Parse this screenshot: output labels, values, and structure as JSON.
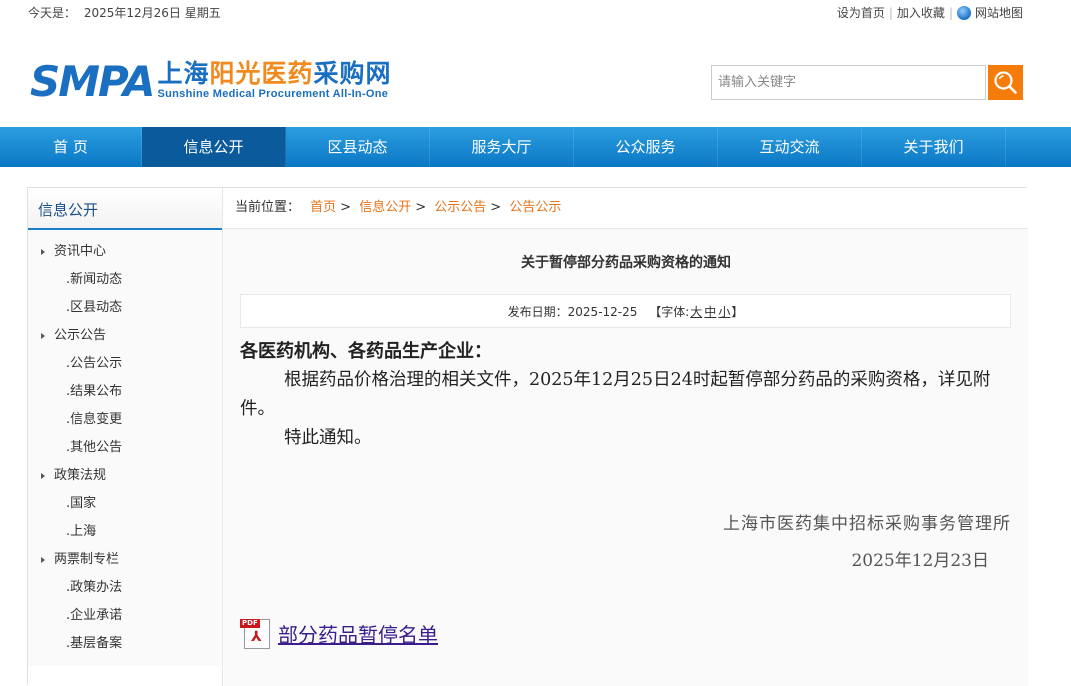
{
  "topbar": {
    "date_label": "今天是：",
    "date_value": "2025年12月26日 星期五",
    "links": [
      "设为首页",
      "加入收藏",
      "网站地图"
    ]
  },
  "header": {
    "logo_abbr": "SMPA",
    "logo_cn_blue1": "上海",
    "logo_cn_orange": "阳光医药",
    "logo_cn_blue2": "采购网",
    "logo_en": "Sunshine Medical Procurement All-In-One",
    "search_placeholder": "请输入关键字"
  },
  "nav": [
    "首 页",
    "信息公开",
    "区县动态",
    "服务大厅",
    "公众服务",
    "互动交流",
    "关于我们"
  ],
  "sidebar": {
    "title": "信息公开",
    "groups": [
      {
        "label": "资讯中心",
        "items": [
          ".新闻动态",
          ".区县动态"
        ]
      },
      {
        "label": "公示公告",
        "items": [
          ".公告公示",
          ".结果公布",
          ".信息变更",
          ".其他公告"
        ]
      },
      {
        "label": "政策法规",
        "items": [
          ".国家",
          ".上海"
        ]
      },
      {
        "label": "两票制专栏",
        "items": [
          ".政策办法",
          ".企业承诺",
          ".基层备案"
        ]
      }
    ]
  },
  "breadcrumb": {
    "label": "当前位置：",
    "items": [
      "首页",
      "信息公开",
      "公示公告",
      "公告公示"
    ]
  },
  "article": {
    "title": "关于暂停部分药品采购资格的通知",
    "publish_label": "发布日期：",
    "publish_date": "2025-12-25",
    "fontsize_prefix": "【字体:",
    "fontsize_options": [
      "大",
      "中",
      "小"
    ],
    "fontsize_suffix": "】",
    "greeting": "各医药机构、各药品生产企业：",
    "paragraphs": [
      "根据药品价格治理的相关文件，2025年12月25日24时起暂停部分药品的采购资格，详见附件。",
      "特此通知。"
    ],
    "signature_org": "上海市医药集中招标采购事务管理所",
    "signature_date": "2025年12月23日",
    "attachment_label": "部分药品暂停名单",
    "attachment_icon_text": "PDF"
  },
  "colors": {
    "brand_blue": "#1a6fc0",
    "accent_orange": "#f57c0b",
    "nav_active": "#0a5a9c",
    "link_orange": "#e8741a"
  }
}
